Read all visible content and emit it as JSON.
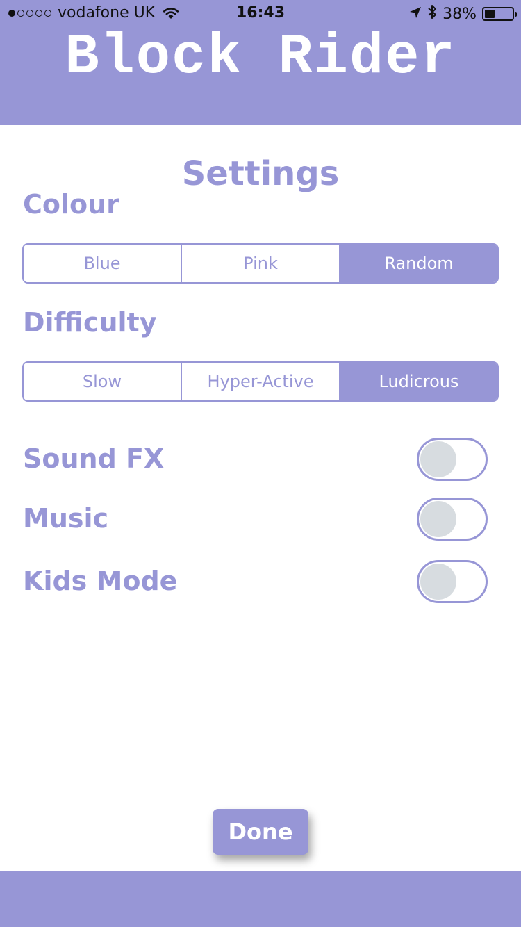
{
  "status_bar": {
    "signal_filled": 1,
    "signal_total": 5,
    "carrier": "vodafone UK",
    "time": "16:43",
    "battery_text": "38%",
    "battery_level": 0.38,
    "icons": [
      "wifi-icon",
      "location-arrow-icon",
      "bluetooth-icon",
      "battery-icon"
    ]
  },
  "header": {
    "title": "Block Rider"
  },
  "settings": {
    "title": "Settings",
    "colour": {
      "label": "Colour",
      "options": [
        "Blue",
        "Pink",
        "Random"
      ],
      "selected": "Random"
    },
    "difficulty": {
      "label": "Difficulty",
      "options": [
        "Slow",
        "Hyper-Active",
        "Ludicrous"
      ],
      "selected": "Ludicrous"
    },
    "toggles": [
      {
        "label": "Sound FX",
        "on": false
      },
      {
        "label": "Music",
        "on": false
      },
      {
        "label": "Kids Mode",
        "on": false
      }
    ]
  },
  "done_label": "Done",
  "colors": {
    "accent": "#9796d6",
    "background": "#ffffff",
    "toggle_knob": "#d7dce0"
  }
}
